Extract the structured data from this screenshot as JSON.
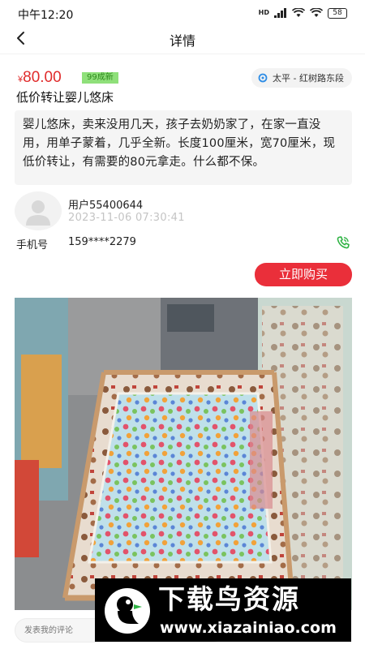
{
  "status_bar": {
    "time": "中午12:20",
    "battery": "58",
    "network": "HD"
  },
  "header": {
    "title": "详情"
  },
  "listing": {
    "currency": "¥",
    "price": "80.00",
    "condition": "99成新",
    "location": "太平 - 红树路东段",
    "title": "低价转让婴儿悠床",
    "description": "婴儿悠床，卖来没用几天，孩子去奶奶家了，在家一直没用，用单子蒙着，几乎全新。长度100厘米，宽70厘米，现低价转让，有需要的80元拿走。什么都不保。"
  },
  "seller": {
    "username": "用户55400644",
    "post_time": "2023-11-06 07:30:41",
    "phone_label": "手机号",
    "phone": "159****2279"
  },
  "actions": {
    "buy_label": "立即购买"
  },
  "comment": {
    "placeholder": "发表我的评论"
  },
  "watermark": {
    "title": "下载鸟资源",
    "url": "www.xiazainiao.com"
  },
  "colors": {
    "accent": "#ea2f3a",
    "price": "#e02b2b",
    "badge_bg": "#8fe07a",
    "call_icon": "#2fb344"
  }
}
